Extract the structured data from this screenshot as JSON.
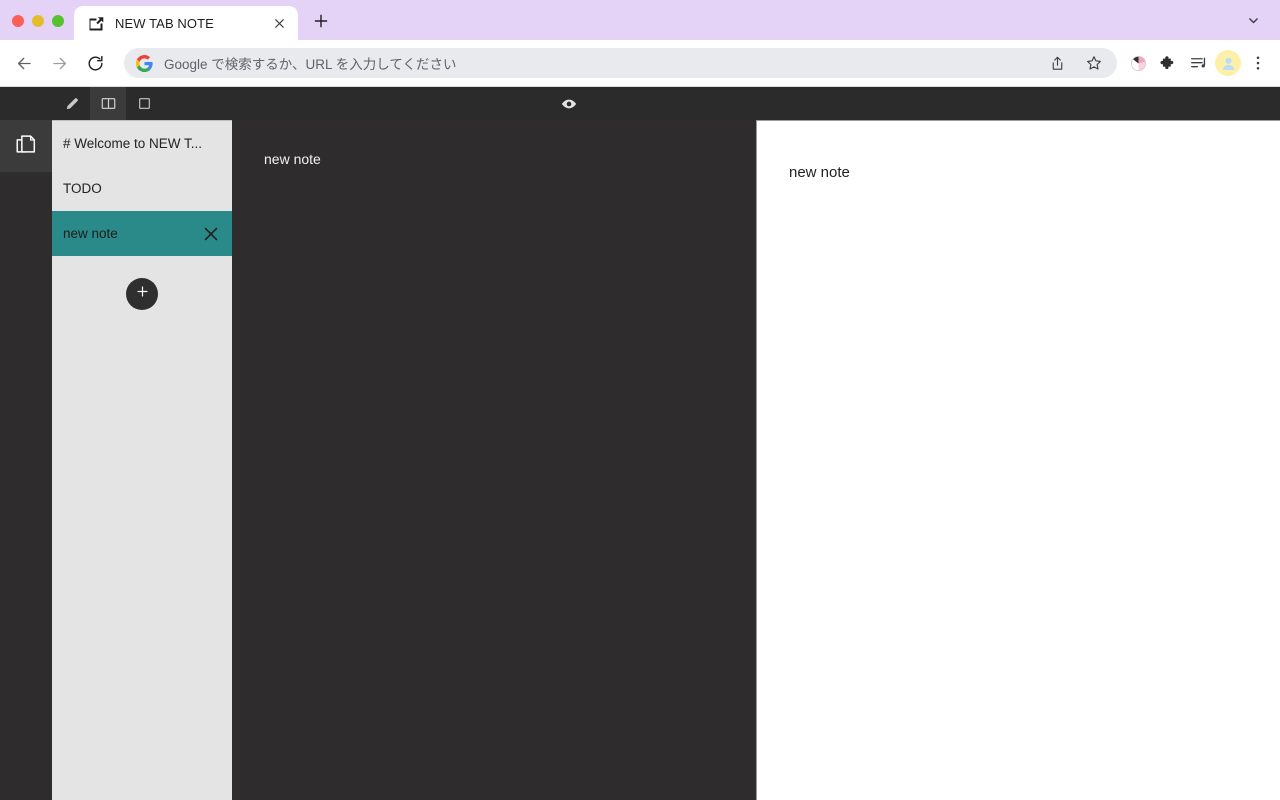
{
  "browser": {
    "tab": {
      "title": "NEW TAB NOTE",
      "favicon_icon": "tab-note-icon",
      "close_icon": "close-icon"
    },
    "new_tab_icon": "plus-icon",
    "tabstrip_chevron_icon": "chevron-down-icon",
    "traffic_lights": [
      "close-red",
      "minimize-yellow",
      "zoom-green"
    ],
    "nav": {
      "back_icon": "arrow-left-icon",
      "forward_icon": "arrow-right-icon",
      "reload_icon": "reload-icon"
    },
    "omnibox": {
      "value": "",
      "placeholder": "Google で検索するか、URL を入力してください",
      "search_engine_icon": "google-g-icon",
      "share_icon": "share-icon",
      "bookmark_icon": "star-icon"
    },
    "toolbar_icons": [
      "color-circle-icon",
      "extensions-puzzle-icon",
      "media-playlist-icon",
      "profile-avatar-icon",
      "three-dot-menu-icon"
    ]
  },
  "app": {
    "toolbar": {
      "modes": [
        {
          "name": "edit-mode",
          "icon": "pencil-icon",
          "active": false
        },
        {
          "name": "split-mode",
          "icon": "split-pane-icon",
          "active": true
        },
        {
          "name": "preview-mode",
          "icon": "single-pane-icon",
          "active": false
        }
      ],
      "preview_toggle_icon": "eye-icon"
    },
    "rail": {
      "notes_icon": "documents-copy-icon",
      "notes_active": true
    },
    "sidebar": {
      "notes": [
        {
          "title": "# Welcome to NEW T...",
          "selected": false
        },
        {
          "title": "TODO",
          "selected": false
        },
        {
          "title": "new note",
          "selected": true,
          "close_icon": "close-icon"
        }
      ],
      "add_button_icon": "plus-icon",
      "selected_color": "#2a8a8a"
    },
    "editor": {
      "content": "new note"
    },
    "preview": {
      "content": "new note"
    }
  }
}
